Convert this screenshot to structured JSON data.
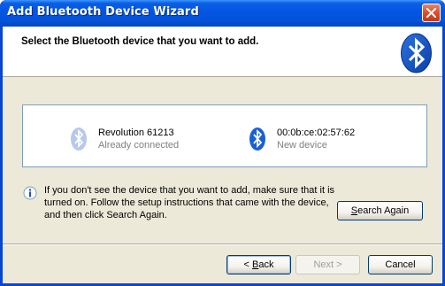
{
  "window": {
    "title": "Add Bluetooth Device Wizard"
  },
  "header": {
    "title": "Select the Bluetooth device that you want to add."
  },
  "devices": [
    {
      "name": "Revolution 61213",
      "status": "Already connected",
      "icon": "bluetooth-icon-light"
    },
    {
      "name": "00:0b:ce:02:57:62",
      "status": "New device",
      "icon": "bluetooth-icon"
    }
  ],
  "info": {
    "icon": "info-icon",
    "text": "If you don't see the device that you want to add, make sure that it is turned on. Follow the setup instructions that came with the device, and then click Search Again."
  },
  "buttons": {
    "search_again": {
      "pre": "",
      "accel": "S",
      "post": "earch Again"
    },
    "back": {
      "pre": "< ",
      "accel": "B",
      "post": "ack"
    },
    "next": "Next >",
    "cancel": "Cancel"
  },
  "colors": {
    "titlebar": "#0356e4",
    "dialog_bg": "#ece9d8",
    "bluetooth": "#1a5fd6"
  }
}
